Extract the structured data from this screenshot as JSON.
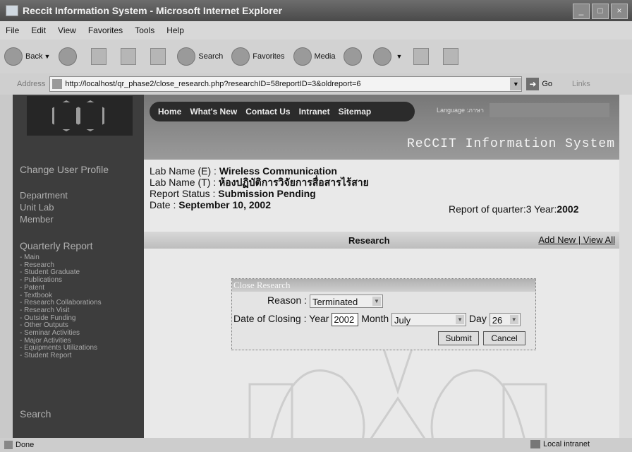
{
  "window": {
    "title": "Reccit Information System - Microsoft Internet Explorer",
    "controls": [
      "_",
      "□",
      "×"
    ]
  },
  "menu": [
    "File",
    "Edit",
    "View",
    "Favorites",
    "Tools",
    "Help"
  ],
  "toolbar": {
    "back": "Back",
    "search": "Search",
    "favorites": "Favorites",
    "media": "Media"
  },
  "address": {
    "label": "Address",
    "url": "http://localhost/qr_phase2/close_research.php?researchID=58reportID=3&oldreport=6",
    "go": "Go",
    "links": "Links"
  },
  "nav": {
    "items": [
      "Home",
      "What's New",
      "Contact Us",
      "Intranet",
      "Sitemap"
    ],
    "language": "Language :ภาษา"
  },
  "site_title": "ReCCIT Information System",
  "sidebar": {
    "change_profile": "Change User Profile",
    "dept_items": [
      "Department",
      "Unit Lab",
      "Member"
    ],
    "quarterly": "Quarterly Report",
    "quarterly_items": [
      "- Main",
      "- Research",
      "- Student Graduate",
      "- Publications",
      "- Patent",
      "- Textbook",
      "- Research Collaborations",
      "- Research Visit",
      "- Outside Funding",
      "- Other Outputs",
      "- Seminar Activities",
      "- Major Activities",
      "- Equipments Utilizations",
      "- Student Report"
    ],
    "search": "Search"
  },
  "info": {
    "lab_e_label": "Lab Name (E) : ",
    "lab_e": "Wireless Communication",
    "lab_t_label": "Lab Name (T) : ",
    "lab_t": "ห้องปฏิบัติการวิจัยการสื่อสารไร้สาย",
    "status_label": "Report Status : ",
    "status": "Submission Pending",
    "date_label": "Date : ",
    "date": "September 10, 2002",
    "quarter_label": "Report of quarter:",
    "quarter": "3",
    "year_label": " Year:",
    "year": "2002"
  },
  "research": {
    "title": "Research",
    "add_new": "Add New",
    "sep": " | ",
    "view_all": "View All"
  },
  "close_form": {
    "title": "Close Research",
    "reason_label": "Reason :",
    "reason_value": "Terminated",
    "date_label": "Date of Closing :",
    "year_label": "Year",
    "year_value": "2002",
    "month_label": "Month",
    "month_value": "July",
    "day_label": "Day",
    "day_value": "26",
    "submit": "Submit",
    "cancel": "Cancel"
  },
  "status": {
    "left": "Done",
    "zone": "Local intranet"
  }
}
